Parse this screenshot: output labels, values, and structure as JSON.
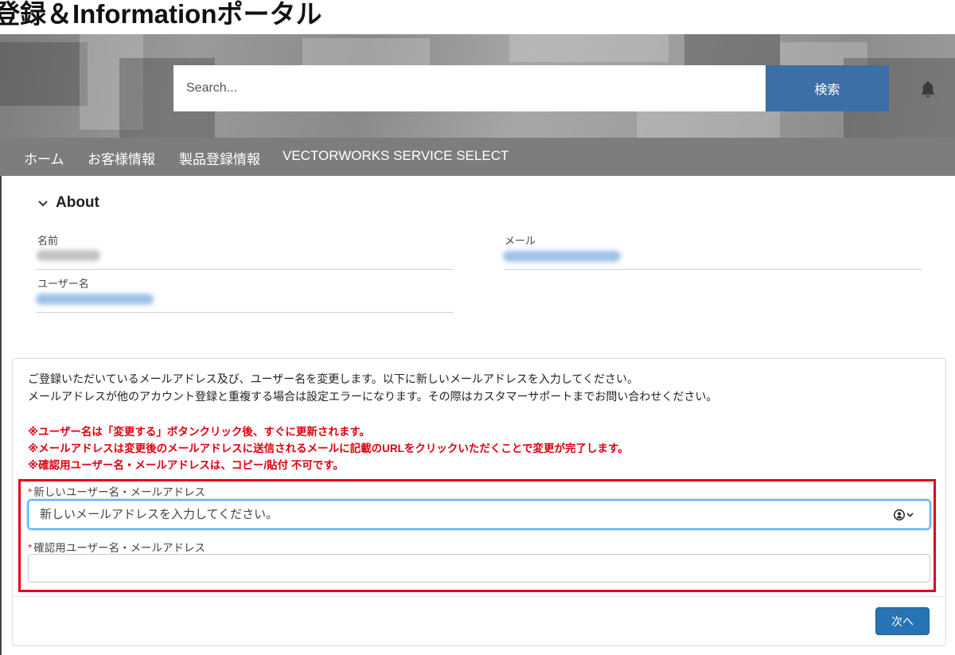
{
  "header": {
    "title": "登録＆Informationポータル"
  },
  "search": {
    "placeholder": "Search...",
    "button_label": "検索"
  },
  "nav": {
    "items": [
      {
        "label": "ホーム"
      },
      {
        "label": "お客様情報"
      },
      {
        "label": "製品登録情報"
      },
      {
        "label": "VECTORWORKS SERVICE SELECT"
      }
    ]
  },
  "about": {
    "title": "About",
    "name_label": "名前",
    "email_label": "メール",
    "username_label": "ユーザー名"
  },
  "form": {
    "info_lines": [
      "ご登録いただいているメールアドレス及び、ユーザー名を変更します。以下に新しいメールアドレスを入力してください。",
      "メールアドレスが他のアカウント登録と重複する場合は設定エラーになります。その際はカスタマーサポートまでお問い合わせください。"
    ],
    "notes": [
      "※ユーザー名は「変更する」ボタンクリック後、すぐに更新されます。",
      "※メールアドレスは変更後のメールアドレスに送信されるメールに記載のURLをクリックいただくことで変更が完了します。",
      "※確認用ユーザー名・メールアドレスは、コピー/貼付 不可です。"
    ],
    "required_marker": "*",
    "new_label": "新しいユーザー名・メールアドレス",
    "new_placeholder": "新しいメールアドレスを入力してください。",
    "confirm_label": "確認用ユーザー名・メールアドレス",
    "confirm_value": "",
    "next_label": "次へ"
  },
  "colors": {
    "nav_bg": "#7d7d7d",
    "search_button": "#3b6fa6",
    "alert_red": "#e0000f",
    "highlight_border": "#e3001b",
    "primary_button": "#2674b4"
  },
  "icons": [
    "bell-icon",
    "chevron-down-icon",
    "contact-autofill-icon"
  ]
}
